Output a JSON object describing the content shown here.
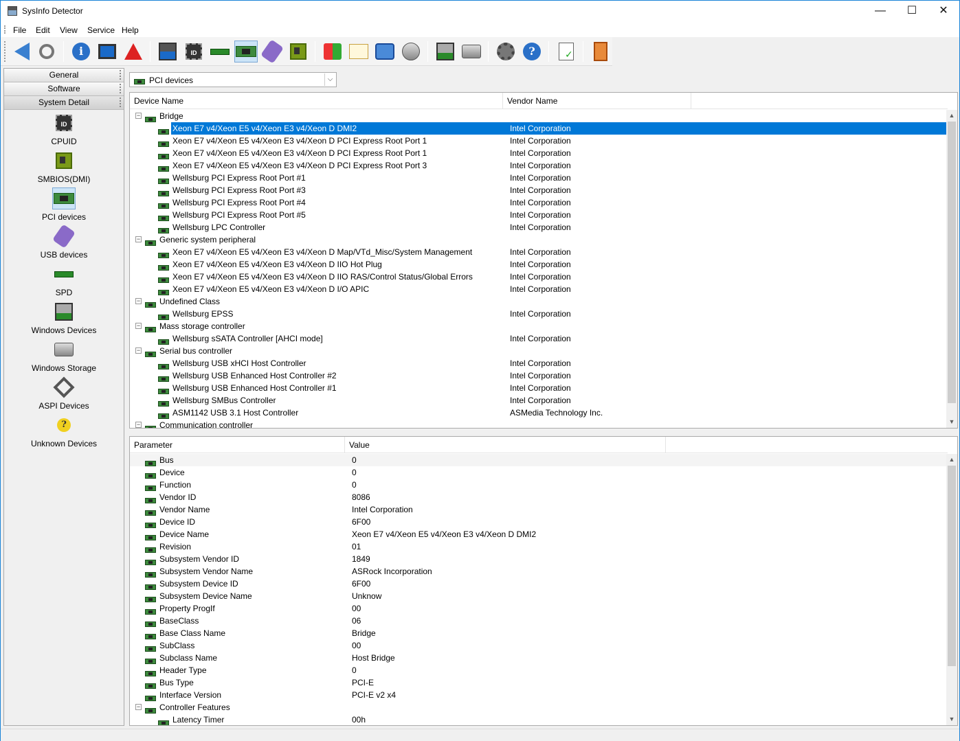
{
  "window": {
    "title": "SysInfo Detector",
    "minimize": "—",
    "maximize": "☐",
    "close": "✕"
  },
  "menu": [
    "File",
    "Edit",
    "View",
    "Service",
    "Help"
  ],
  "toolbar": {
    "icons": [
      "back-icon",
      "search-icon",
      "info-icon",
      "monitor-icon",
      "warning-icon",
      "computer-icon",
      "cpuid-icon",
      "memory-icon",
      "pci-card-icon",
      "usb-icon",
      "motherboard-icon",
      "windows-icon",
      "certificate-icon",
      "network-icon",
      "disc-icon",
      "drivers-icon",
      "storage-icon",
      "settings-icon",
      "help-icon",
      "report-icon",
      "exit-icon"
    ],
    "active": "pci-card-icon"
  },
  "sidebar": {
    "tabs": [
      "General",
      "Software",
      "System Detail"
    ],
    "active_tab": "System Detail",
    "items": [
      {
        "label": "CPUID",
        "icon": "cpuid-icon"
      },
      {
        "label": "SMBIOS(DMI)",
        "icon": "motherboard-icon"
      },
      {
        "label": "PCI devices",
        "icon": "pci-card-icon"
      },
      {
        "label": "USB devices",
        "icon": "usb-icon"
      },
      {
        "label": "SPD",
        "icon": "memory-icon"
      },
      {
        "label": "Windows Devices",
        "icon": "drivers-icon"
      },
      {
        "label": "Windows Storage",
        "icon": "storage-icon"
      },
      {
        "label": "ASPI Devices",
        "icon": "aspi-icon"
      },
      {
        "label": "Unknown Devices",
        "icon": "unknown-icon"
      }
    ],
    "active_item": "PCI devices"
  },
  "combo": {
    "value": "PCI devices",
    "arrow": "⌵"
  },
  "devices": {
    "headers": {
      "name": "Device Name",
      "vendor": "Vendor Name"
    },
    "rows": [
      {
        "level": 0,
        "name": "Bridge",
        "vendor": ""
      },
      {
        "level": 1,
        "name": "Xeon E7 v4/Xeon E5 v4/Xeon E3 v4/Xeon D DMI2",
        "vendor": "Intel Corporation",
        "selected": true
      },
      {
        "level": 1,
        "name": "Xeon E7 v4/Xeon E5 v4/Xeon E3 v4/Xeon D PCI Express Root Port 1",
        "vendor": "Intel Corporation"
      },
      {
        "level": 1,
        "name": "Xeon E7 v4/Xeon E5 v4/Xeon E3 v4/Xeon D PCI Express Root Port 1",
        "vendor": "Intel Corporation"
      },
      {
        "level": 1,
        "name": "Xeon E7 v4/Xeon E5 v4/Xeon E3 v4/Xeon D PCI Express Root Port 3",
        "vendor": "Intel Corporation"
      },
      {
        "level": 1,
        "name": "Wellsburg PCI Express Root Port #1",
        "vendor": "Intel Corporation"
      },
      {
        "level": 1,
        "name": "Wellsburg PCI Express Root Port #3",
        "vendor": "Intel Corporation"
      },
      {
        "level": 1,
        "name": "Wellsburg PCI Express Root Port #4",
        "vendor": "Intel Corporation"
      },
      {
        "level": 1,
        "name": "Wellsburg PCI Express Root Port #5",
        "vendor": "Intel Corporation"
      },
      {
        "level": 1,
        "name": "Wellsburg LPC Controller",
        "vendor": "Intel Corporation"
      },
      {
        "level": 0,
        "name": "Generic system peripheral",
        "vendor": ""
      },
      {
        "level": 1,
        "name": "Xeon E7 v4/Xeon E5 v4/Xeon E3 v4/Xeon D Map/VTd_Misc/System Management",
        "vendor": "Intel Corporation"
      },
      {
        "level": 1,
        "name": "Xeon E7 v4/Xeon E5 v4/Xeon E3 v4/Xeon D IIO Hot Plug",
        "vendor": "Intel Corporation"
      },
      {
        "level": 1,
        "name": "Xeon E7 v4/Xeon E5 v4/Xeon E3 v4/Xeon D IIO RAS/Control Status/Global Errors",
        "vendor": "Intel Corporation"
      },
      {
        "level": 1,
        "name": "Xeon E7 v4/Xeon E5 v4/Xeon E3 v4/Xeon D I/O APIC",
        "vendor": "Intel Corporation"
      },
      {
        "level": 0,
        "name": "Undefined Class",
        "vendor": ""
      },
      {
        "level": 1,
        "name": "Wellsburg EPSS",
        "vendor": "Intel Corporation"
      },
      {
        "level": 0,
        "name": "Mass storage controller",
        "vendor": ""
      },
      {
        "level": 1,
        "name": "Wellsburg sSATA Controller [AHCI mode]",
        "vendor": "Intel Corporation"
      },
      {
        "level": 0,
        "name": "Serial bus controller",
        "vendor": ""
      },
      {
        "level": 1,
        "name": "Wellsburg USB xHCI Host Controller",
        "vendor": "Intel Corporation"
      },
      {
        "level": 1,
        "name": "Wellsburg USB Enhanced Host Controller #2",
        "vendor": "Intel Corporation"
      },
      {
        "level": 1,
        "name": "Wellsburg USB Enhanced Host Controller #1",
        "vendor": "Intel Corporation"
      },
      {
        "level": 1,
        "name": "Wellsburg SMBus Controller",
        "vendor": "Intel Corporation"
      },
      {
        "level": 1,
        "name": "ASM1142 USB 3.1 Host Controller",
        "vendor": "ASMedia Technology Inc."
      },
      {
        "level": 0,
        "name": "Communication controller",
        "vendor": ""
      }
    ]
  },
  "details": {
    "headers": {
      "param": "Parameter",
      "value": "Value"
    },
    "rows": [
      {
        "level": 0,
        "param": "Bus",
        "value": "0"
      },
      {
        "level": 0,
        "param": "Device",
        "value": "0"
      },
      {
        "level": 0,
        "param": "Function",
        "value": "0"
      },
      {
        "level": 0,
        "param": "Vendor ID",
        "value": "8086"
      },
      {
        "level": 0,
        "param": "Vendor Name",
        "value": "Intel Corporation"
      },
      {
        "level": 0,
        "param": "Device ID",
        "value": "6F00"
      },
      {
        "level": 0,
        "param": "Device Name",
        "value": "Xeon E7 v4/Xeon E5 v4/Xeon E3 v4/Xeon D DMI2"
      },
      {
        "level": 0,
        "param": "Revision",
        "value": "01"
      },
      {
        "level": 0,
        "param": "Subsystem Vendor ID",
        "value": "1849"
      },
      {
        "level": 0,
        "param": "Subsystem Vendor Name",
        "value": "ASRock Incorporation"
      },
      {
        "level": 0,
        "param": "Subsystem Device ID",
        "value": "6F00"
      },
      {
        "level": 0,
        "param": "Subsystem Device Name",
        "value": "Unknow"
      },
      {
        "level": 0,
        "param": "Property ProgIf",
        "value": "00"
      },
      {
        "level": 0,
        "param": "BaseClass",
        "value": "06"
      },
      {
        "level": 0,
        "param": "Base Class Name",
        "value": "Bridge"
      },
      {
        "level": 0,
        "param": "SubClass",
        "value": "00"
      },
      {
        "level": 0,
        "param": "Subclass Name",
        "value": "Host Bridge"
      },
      {
        "level": 0,
        "param": "Header Type",
        "value": "0"
      },
      {
        "level": 0,
        "param": "Bus Type",
        "value": "PCI-E"
      },
      {
        "level": 0,
        "param": "Interface Version",
        "value": "PCI-E v2 x4"
      },
      {
        "level": -1,
        "param": "Controller Features",
        "value": ""
      },
      {
        "level": 1,
        "param": "Latency Timer",
        "value": "00h"
      }
    ]
  },
  "colors": {
    "selection": "#0078d7",
    "border": "#1883d7"
  }
}
